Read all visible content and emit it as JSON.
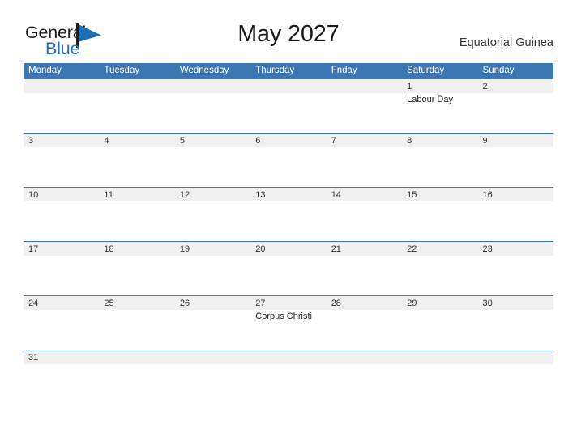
{
  "brand": {
    "name_part1": "General",
    "name_part2": "Blue",
    "flag_icon": "blue-triangle-flag",
    "accent_blue": "#1f6fb8",
    "text_black": "#231f20"
  },
  "header": {
    "title": "May 2027",
    "region": "Equatorial Guinea"
  },
  "calendar": {
    "header_bg": "#3c77b3",
    "band_bg": "#f0f0f0",
    "weekdays": [
      "Monday",
      "Tuesday",
      "Wednesday",
      "Thursday",
      "Friday",
      "Saturday",
      "Sunday"
    ],
    "weeks": [
      {
        "days": [
          {
            "num": "",
            "events": []
          },
          {
            "num": "",
            "events": []
          },
          {
            "num": "",
            "events": []
          },
          {
            "num": "",
            "events": []
          },
          {
            "num": "",
            "events": []
          },
          {
            "num": "1",
            "events": [
              "Labour Day"
            ]
          },
          {
            "num": "2",
            "events": []
          }
        ]
      },
      {
        "days": [
          {
            "num": "3",
            "events": []
          },
          {
            "num": "4",
            "events": []
          },
          {
            "num": "5",
            "events": []
          },
          {
            "num": "6",
            "events": []
          },
          {
            "num": "7",
            "events": []
          },
          {
            "num": "8",
            "events": []
          },
          {
            "num": "9",
            "events": []
          }
        ]
      },
      {
        "days": [
          {
            "num": "10",
            "events": []
          },
          {
            "num": "11",
            "events": []
          },
          {
            "num": "12",
            "events": []
          },
          {
            "num": "13",
            "events": []
          },
          {
            "num": "14",
            "events": []
          },
          {
            "num": "15",
            "events": []
          },
          {
            "num": "16",
            "events": []
          }
        ]
      },
      {
        "days": [
          {
            "num": "17",
            "events": []
          },
          {
            "num": "18",
            "events": []
          },
          {
            "num": "19",
            "events": []
          },
          {
            "num": "20",
            "events": []
          },
          {
            "num": "21",
            "events": []
          },
          {
            "num": "22",
            "events": []
          },
          {
            "num": "23",
            "events": []
          }
        ]
      },
      {
        "days": [
          {
            "num": "24",
            "events": []
          },
          {
            "num": "25",
            "events": []
          },
          {
            "num": "26",
            "events": []
          },
          {
            "num": "27",
            "events": [
              "Corpus Christi"
            ]
          },
          {
            "num": "28",
            "events": []
          },
          {
            "num": "29",
            "events": []
          },
          {
            "num": "30",
            "events": []
          }
        ]
      },
      {
        "days": [
          {
            "num": "31",
            "events": []
          },
          {
            "num": "",
            "events": []
          },
          {
            "num": "",
            "events": []
          },
          {
            "num": "",
            "events": []
          },
          {
            "num": "",
            "events": []
          },
          {
            "num": "",
            "events": []
          },
          {
            "num": "",
            "events": []
          }
        ]
      }
    ]
  }
}
